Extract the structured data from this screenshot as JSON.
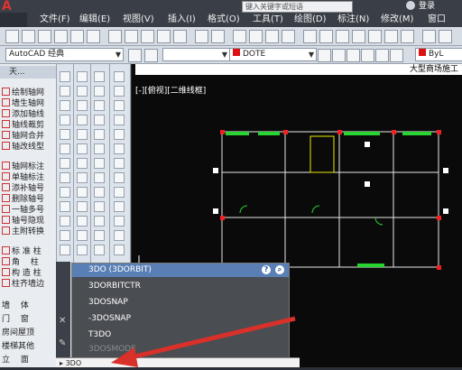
{
  "titlebar": {
    "search_placeholder": "键入关键字或短语",
    "login": "登录"
  },
  "menu": [
    "文件(F)",
    "编辑(E)",
    "视图(V)",
    "插入(I)",
    "格式(O)",
    "工具(T)",
    "绘图(D)",
    "标注(N)",
    "修改(M)",
    "窗口"
  ],
  "toolbar": {
    "workspace": "AutoCAD 经典",
    "linetype": "DOTE",
    "lineweight": "ByL"
  },
  "left_panel": {
    "title": "天...",
    "items": [
      "绘制轴网",
      "墙生轴网",
      "添加轴线",
      "轴线裁剪",
      "轴网合并",
      "轴改线型",
      "轴网标注",
      "单轴标注",
      "添补轴号",
      "删除轴号",
      "一轴多号",
      "轴号隐现",
      "主附转换",
      "标 准 柱",
      "角　 柱",
      "构 造 柱",
      "柱齐墙边",
      "墙　 体",
      "门　 窗",
      "房间屋顶",
      "楼梯其他",
      "立　 面"
    ]
  },
  "drawing": {
    "tab_title": "大型商场施工",
    "view_label": "[-][俯视][二维线框]"
  },
  "autocomplete": {
    "items": [
      "3DO (3DORBIT)",
      "3DORBITCTR",
      "3DOSNAP",
      "-3DOSNAP",
      "T3DO",
      "3DOSMODE"
    ]
  },
  "command_line": {
    "value": "3DO"
  },
  "colors": {
    "menubar": "#3a3f47",
    "canvas": "#0a0a0a",
    "popup": "#4a4d52",
    "highlight": "#5a7fb5",
    "arrow": "#d9302a"
  }
}
